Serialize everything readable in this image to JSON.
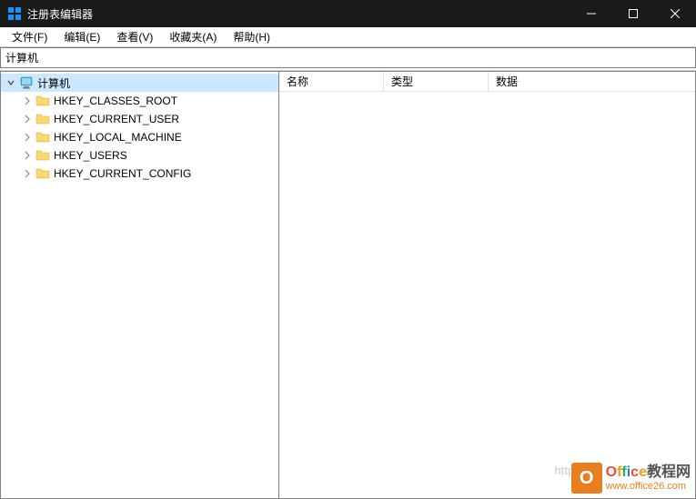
{
  "titlebar": {
    "title": "注册表编辑器"
  },
  "menubar": {
    "items": [
      {
        "label": "文件(F)"
      },
      {
        "label": "编辑(E)"
      },
      {
        "label": "查看(V)"
      },
      {
        "label": "收藏夹(A)"
      },
      {
        "label": "帮助(H)"
      }
    ]
  },
  "addressbar": {
    "path": "计算机"
  },
  "tree": {
    "root": {
      "label": "计算机"
    },
    "children": [
      {
        "label": "HKEY_CLASSES_ROOT"
      },
      {
        "label": "HKEY_CURRENT_USER"
      },
      {
        "label": "HKEY_LOCAL_MACHINE"
      },
      {
        "label": "HKEY_USERS"
      },
      {
        "label": "HKEY_CURRENT_CONFIG"
      }
    ]
  },
  "list": {
    "columns": {
      "name": "名称",
      "type": "类型",
      "data": "数据"
    }
  },
  "watermark": {
    "text": "https://blog.csdn...",
    "logo_line1": "Office教程网",
    "logo_line2": "www.office26.com"
  }
}
